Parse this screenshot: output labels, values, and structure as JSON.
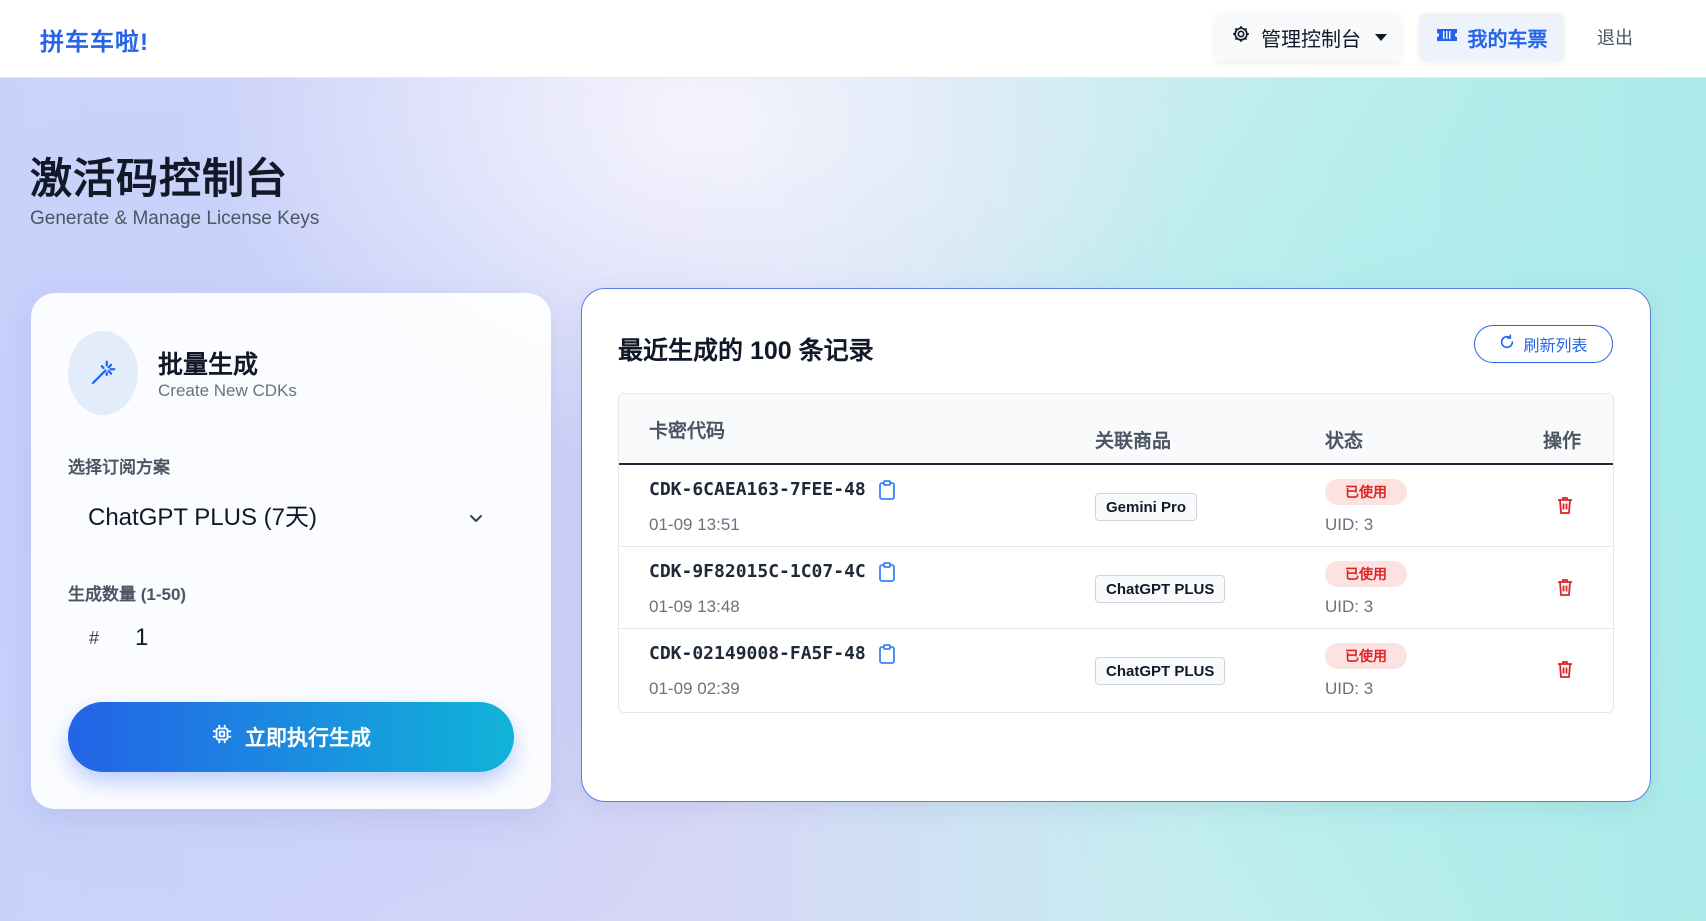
{
  "header": {
    "brand": "拼车车啦!",
    "admin_menu": "管理控制台",
    "my_tickets": "我的车票",
    "logout": "退出"
  },
  "page": {
    "title": "激活码控制台",
    "subtitle": "Generate & Manage License Keys"
  },
  "generator": {
    "title": "批量生成",
    "subtitle": "Create New CDKs",
    "plan_label": "选择订阅方案",
    "plan_value": "ChatGPT PLUS (7天)",
    "quantity_label": "生成数量 (1-50)",
    "quantity_prefix": "#",
    "quantity_value": "1",
    "submit_label": "立即执行生成"
  },
  "records": {
    "title": "最近生成的 100 条记录",
    "refresh_label": "刷新列表",
    "columns": [
      "卡密代码",
      "关联商品",
      "状态",
      "操作"
    ],
    "rows": [
      {
        "code": "CDK-6CAEA163-7FEE-48",
        "time": "01-09 13:51",
        "product": "Gemini Pro",
        "status": "已使用",
        "uid": "UID: 3"
      },
      {
        "code": "CDK-9F82015C-1C07-4C",
        "time": "01-09 13:48",
        "product": "ChatGPT PLUS",
        "status": "已使用",
        "uid": "UID: 3"
      },
      {
        "code": "CDK-02149008-FA5F-48",
        "time": "01-09 02:39",
        "product": "ChatGPT PLUS",
        "status": "已使用",
        "uid": "UID: 3"
      }
    ]
  },
  "icons": {
    "admin": "gear-icon",
    "tickets": "ticket-icon",
    "generator": "magic-wand-icon",
    "select": "chevron-down-icon",
    "submit": "chip-icon",
    "refresh": "refresh-icon",
    "copy": "clipboard-icon",
    "delete": "trash-icon"
  },
  "colors": {
    "accent": "#2563eb",
    "danger": "#dc2626",
    "badge_bg": "#fde2e2"
  }
}
